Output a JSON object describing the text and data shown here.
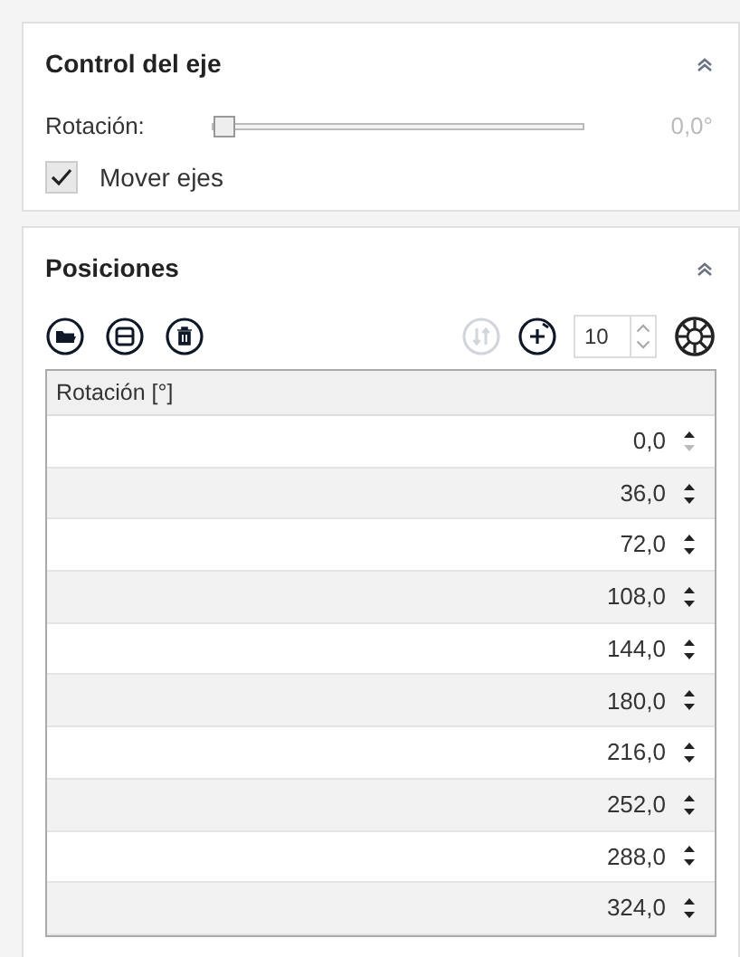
{
  "axis_control": {
    "title": "Control del eje",
    "slider": {
      "label": "Rotación:",
      "level": 0,
      "reading": "0,0°"
    },
    "move_axes": {
      "label": "Mover ejes",
      "checked": true
    }
  },
  "positions": {
    "title": "Posiciones",
    "toolbar": {
      "swap_disabled": true,
      "count": "10"
    },
    "table": {
      "column": "Rotación [°]",
      "rows": [
        {
          "value": "0,0",
          "down_disabled": true
        },
        {
          "value": "36,0",
          "down_disabled": false
        },
        {
          "value": "72,0",
          "down_disabled": false
        },
        {
          "value": "108,0",
          "down_disabled": false
        },
        {
          "value": "144,0",
          "down_disabled": false
        },
        {
          "value": "180,0",
          "down_disabled": false
        },
        {
          "value": "216,0",
          "down_disabled": false
        },
        {
          "value": "252,0",
          "down_disabled": false
        },
        {
          "value": "288,0",
          "down_disabled": false
        },
        {
          "value": "324,0",
          "down_disabled": false
        }
      ]
    }
  }
}
